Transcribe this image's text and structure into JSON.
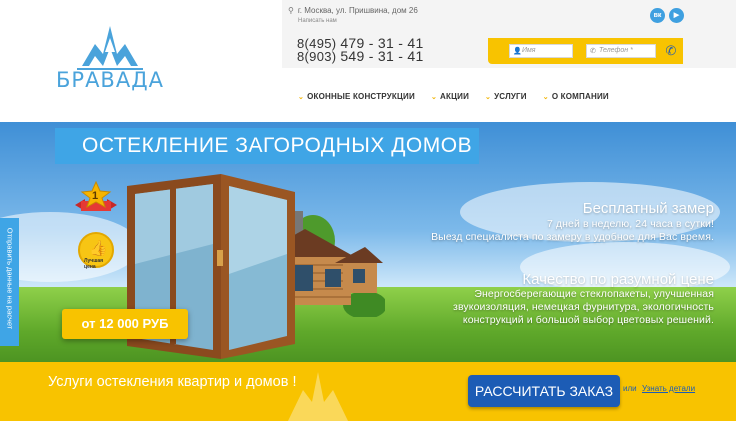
{
  "header": {
    "logo_text": "БРАВАДА",
    "address": "г. Москва, ул. Пришвина, дом 26",
    "write_us": "Написать нам",
    "phones": [
      {
        "prefix": "8(495)",
        "number": "479 - 31 - 41"
      },
      {
        "prefix": "8(903)",
        "number": "549 - 31 - 41"
      }
    ],
    "social": [
      {
        "name": "vk-icon",
        "label": "вк"
      },
      {
        "name": "youtube-icon",
        "label": "▶"
      }
    ],
    "callback": {
      "name_placeholder": "Имя",
      "phone_placeholder": "Телефон *"
    },
    "nav": [
      "ОКОННЫЕ КОНСТРУКЦИИ",
      "АКЦИИ",
      "УСЛУГИ",
      "О КОМПАНИИ"
    ]
  },
  "hero": {
    "banner": "ОСТЕКЛЕНИЕ ЗАГОРОДНЫХ ДОМОВ",
    "badge_number": "1",
    "badge_caption": "Лучшая цена",
    "price": "от 12 000 РУБ",
    "feature1": {
      "title": "Бесплатный замер",
      "lines": [
        "7 дней в неделю, 24 часа в сутки!",
        "Выезд специалиста по замеру в удобное для Вас время."
      ]
    },
    "feature2": {
      "title": "Качество по разумной цене",
      "lines": [
        "Энергосберегающие стеклопакеты, улучшенная",
        "звукоизоляция, немецкая фурнитура, экологичность",
        "конструкций и большой выбор цветовых решений."
      ]
    }
  },
  "bottom": {
    "slogan": "Услуги остекления квартир и домов !",
    "calc_button": "РАССЧИТАТЬ ЗАКАЗ",
    "or": "или",
    "details": "Узнать детали"
  },
  "sidetab": "Отправить данные на расчет",
  "colors": {
    "accent_yellow": "#f8c300",
    "accent_blue": "#3fa5e6",
    "button_blue": "#1c5cb5"
  }
}
